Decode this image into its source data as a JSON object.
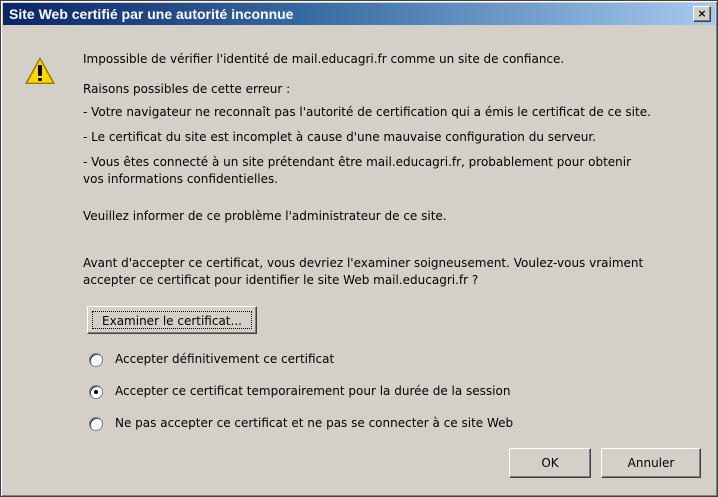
{
  "window": {
    "title": "Site Web certifié par une autorité inconnue",
    "close_label": "×"
  },
  "icons": {
    "warning": "warning-triangle-icon"
  },
  "message": {
    "intro": "Impossible de vérifier l'identité de mail.educagri.fr comme un site de confiance.",
    "reasons_heading": "Raisons possibles de cette erreur :",
    "reason_1": "- Votre navigateur ne reconnaît pas l'autorité de certification qui a émis le certificat de ce site.",
    "reason_2": "- Le certificat du site est incomplet à cause d'une mauvaise configuration du serveur.",
    "reason_3_line1": "- Vous êtes connecté à un site prétendant être mail.educagri.fr, probablement pour obtenir",
    "reason_3_line2": "vos informations confidentielles.",
    "inform": "Veuillez informer de ce problème l'administrateur de ce site.",
    "question_line1": "Avant d'accepter ce certificat, vous devriez l'examiner soigneusement. Voulez-vous vraiment",
    "question_line2": "accepter ce certificat pour identifier le site Web mail.educagri.fr ?"
  },
  "inspect_button": "Examiner le certificat...",
  "options": [
    {
      "label": "Accepter définitivement ce certificat",
      "selected": false
    },
    {
      "label": "Accepter ce certificat temporairement pour la durée de la session",
      "selected": true
    },
    {
      "label": "Ne pas accepter ce certificat et ne pas se connecter à ce site Web",
      "selected": false
    }
  ],
  "buttons": {
    "ok": "OK",
    "cancel": "Annuler"
  },
  "colors": {
    "title_gradient_start": "#0a246a",
    "title_gradient_end": "#a6caf0",
    "dialog_face": "#d4d0c8",
    "warning_yellow": "#ffd800"
  }
}
